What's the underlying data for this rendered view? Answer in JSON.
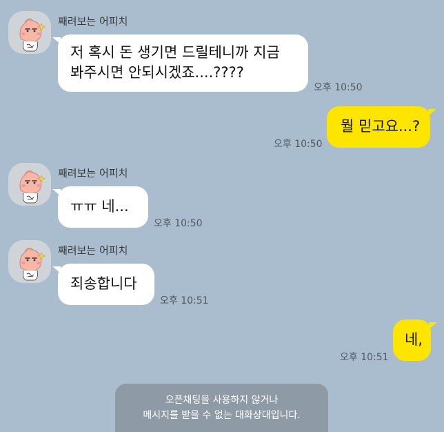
{
  "messages": [
    {
      "direction": "incoming",
      "sender": "째려보는 어피치",
      "lines": [
        "저 혹시 돈 생기면 드릴테니까 지금",
        "봐주시면 안되시겠죠....????"
      ],
      "time": "오후 10:50"
    },
    {
      "direction": "outgoing",
      "text": "뭘 믿고요...?",
      "time": "오후 10:50"
    },
    {
      "direction": "incoming",
      "sender": "째려보는 어피치",
      "text": "ㅠㅠ 네...",
      "time": "오후 10:50"
    },
    {
      "direction": "incoming",
      "sender": "째려보는 어피치",
      "text": "죄송합니다",
      "time": "오후 10:51"
    },
    {
      "direction": "outgoing",
      "text": "네,",
      "time": "오후 10:51"
    }
  ],
  "notice": {
    "line1": "오픈채팅을 사용하지 않거나",
    "line2": "메시지를 받을 수 없는 대화상대입니다."
  },
  "colors": {
    "background": "#a9bdce",
    "incoming_bubble": "#ffffff",
    "outgoing_bubble": "#fee500",
    "notice_bg": "#8e9aa5"
  },
  "avatar_icon": "apeach-peach-character-icon"
}
